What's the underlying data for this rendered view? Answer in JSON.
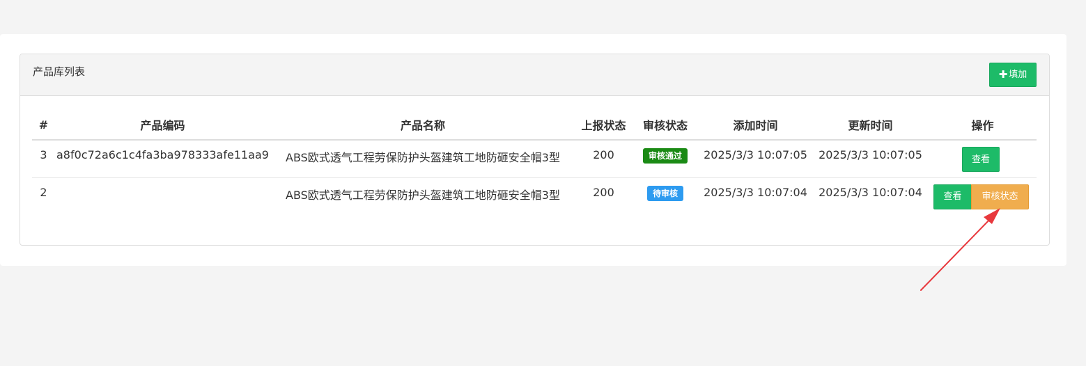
{
  "panel": {
    "title": "产品库列表",
    "add_label": "填加",
    "add_icon": "plus-icon"
  },
  "table": {
    "headers": [
      "#",
      "产品编码",
      "产品名称",
      "上报状态",
      "审核状态",
      "添加时间",
      "更新时间",
      "操作"
    ],
    "rows": [
      {
        "id": "3",
        "code": "a8f0c72a6c1c4fa3ba978333afe11aa9",
        "name": "ABS欧式透气工程劳保防护头盔建筑工地防砸安全帽3型",
        "report_status": "200",
        "review_status": "审核通过",
        "review_color": "#1a8a14",
        "added": "2025/3/3 10:07:05",
        "updated": "2025/3/3 10:07:05",
        "actions": [
          "查看"
        ]
      },
      {
        "id": "2",
        "code": "",
        "name": "ABS欧式透气工程劳保防护头盔建筑工地防砸安全帽3型",
        "report_status": "200",
        "review_status": "待审核",
        "review_color": "#2d9bf0",
        "added": "2025/3/3 10:07:04",
        "updated": "2025/3/3 10:07:04",
        "actions": [
          "查看",
          "审核状态"
        ]
      }
    ]
  },
  "colors": {
    "primary_green": "#1dbb68",
    "warning_orange": "#f0ad4e",
    "annotation_arrow": "#e8383d"
  }
}
